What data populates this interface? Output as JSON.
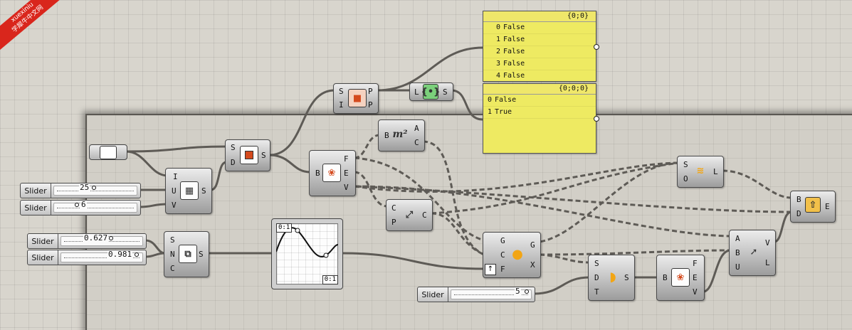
{
  "watermark": {
    "line1": "xuexiniu",
    "line2": "学犀牛中文网"
  },
  "panels": {
    "list1": {
      "header": "{0;0}",
      "rows": [
        {
          "i": "0",
          "v": "False"
        },
        {
          "i": "1",
          "v": "False"
        },
        {
          "i": "2",
          "v": "False"
        },
        {
          "i": "3",
          "v": "False"
        },
        {
          "i": "4",
          "v": "False"
        }
      ]
    },
    "list2": {
      "header": "{0;0;0}",
      "rows": [
        {
          "i": "0",
          "v": "False"
        },
        {
          "i": "1",
          "v": "True"
        }
      ]
    }
  },
  "sliders": {
    "s25": {
      "label": "Slider",
      "value": "25"
    },
    "s6": {
      "label": "Slider",
      "value": "6"
    },
    "s0627": {
      "label": "Slider",
      "value": "0.627"
    },
    "s0981": {
      "label": "Slider",
      "value": "0.981"
    },
    "s5": {
      "label": "Slider",
      "value": "5"
    }
  },
  "graph": {
    "tag_top": "0:1",
    "tag_bottom": "0:1"
  },
  "components": {
    "brep_param": {
      "icon": "brep-param-icon"
    },
    "isotrim": {
      "in": [
        "S",
        "D"
      ],
      "out": [
        "S"
      ]
    },
    "divide_domain": {
      "in": [
        "I",
        "U",
        "V"
      ],
      "out": [
        "S"
      ]
    },
    "point_in_brep": {
      "in": [
        "S",
        "I"
      ],
      "out": [
        "P",
        "P"
      ]
    },
    "flatten": {
      "in": [
        "L"
      ],
      "out": [
        "S"
      ]
    },
    "deconstruct_brep1": {
      "in": [
        "B"
      ],
      "out": [
        "F",
        "E",
        "V"
      ]
    },
    "area": {
      "in": [
        "B"
      ],
      "out": [
        "A",
        "C"
      ],
      "icon_text": "m²"
    },
    "closest_point": {
      "in": [
        "C",
        "P"
      ],
      "out": [
        "C"
      ]
    },
    "populate": {
      "in": [
        "S",
        "N",
        "C"
      ],
      "out": [
        "S"
      ]
    },
    "sdl_line": {
      "in": [
        "G",
        "C",
        "F"
      ],
      "out": [
        "G",
        "X"
      ]
    },
    "shift_list": {
      "in": [
        "S",
        "O"
      ],
      "out": [
        "L"
      ]
    },
    "brep_from_points": {
      "in": [
        "B",
        "D"
      ],
      "out": [
        "E"
      ]
    },
    "line_sdl": {
      "in": [
        "A",
        "B",
        "U"
      ],
      "out": [
        "V",
        "L"
      ]
    },
    "sweep": {
      "in": [
        "S",
        "D",
        "T"
      ],
      "out": [
        "S"
      ]
    },
    "deconstruct_brep2": {
      "in": [
        "B"
      ],
      "out": [
        "F",
        "E",
        "V"
      ]
    }
  }
}
